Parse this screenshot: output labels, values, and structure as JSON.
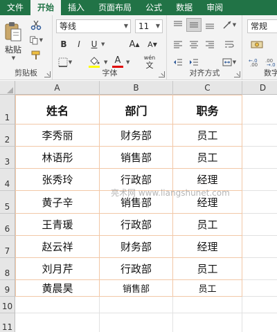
{
  "tabs": [
    "文件",
    "开始",
    "插入",
    "页面布局",
    "公式",
    "数据",
    "审阅"
  ],
  "active_tab_index": 1,
  "ribbon": {
    "clipboard": {
      "label": "剪贴板",
      "paste_label": "粘贴"
    },
    "font": {
      "label": "字体",
      "font_name": "等线",
      "font_size": "11",
      "bold": "B",
      "italic": "I",
      "underline": "U",
      "grow": "A",
      "shrink": "A",
      "font_color_glyph": "A",
      "phonetic_glyph": "wén",
      "phonetic_sub": "文"
    },
    "alignment": {
      "label": "对齐方式"
    },
    "number": {
      "label": "数字",
      "format": "常规"
    }
  },
  "columns": [
    "A",
    "B",
    "C",
    "D"
  ],
  "rows": [
    "1",
    "2",
    "3",
    "4",
    "5",
    "6",
    "7",
    "8",
    "9",
    "10",
    "11"
  ],
  "table": {
    "headers": [
      "姓名",
      "部门",
      "职务"
    ],
    "records": [
      [
        "李秀丽",
        "财务部",
        "员工"
      ],
      [
        "林语彤",
        "销售部",
        "员工"
      ],
      [
        "张秀玲",
        "行政部",
        "经理"
      ],
      [
        "黄子辛",
        "销售部",
        "经理"
      ],
      [
        "王青瑗",
        "行政部",
        "员工"
      ],
      [
        "赵云祥",
        "财务部",
        "经理"
      ],
      [
        "刘月芹",
        "行政部",
        "员工"
      ],
      [
        "黄晨昊",
        "销售部",
        "员工"
      ]
    ]
  },
  "watermark": "亮术网 www.liangshunet.com",
  "colors": {
    "ribbon_green": "#217346",
    "table_border": "#f2c7a6",
    "font_color_bar": "#e00000",
    "highlight_bar": "#ffff00"
  }
}
